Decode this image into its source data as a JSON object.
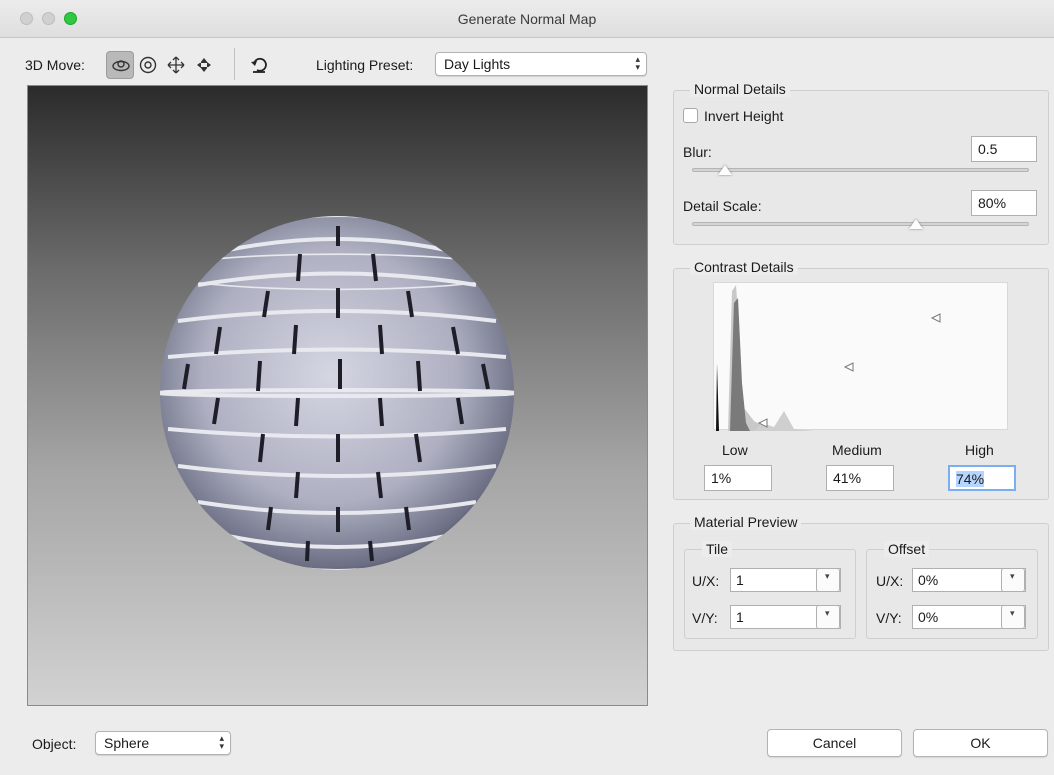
{
  "window": {
    "title": "Generate Normal Map"
  },
  "toolbar": {
    "move_label": "3D Move:",
    "tools": [
      "orbit-tool",
      "roll-tool",
      "pan-tool",
      "slide-tool"
    ],
    "reset_icon": "reset-view-icon",
    "lighting_label": "Lighting Preset:",
    "lighting_value": "Day Lights"
  },
  "normal_details": {
    "title": "Normal Details",
    "invert_height_label": "Invert Height",
    "invert_height_checked": false,
    "blur_label": "Blur:",
    "blur_value": "0.5",
    "detail_scale_label": "Detail Scale:",
    "detail_scale_value": "80%"
  },
  "contrast_details": {
    "title": "Contrast Details",
    "low_label": "Low",
    "medium_label": "Medium",
    "high_label": "High",
    "low_value": "1%",
    "medium_value": "41%",
    "high_value": "74%"
  },
  "material_preview": {
    "title": "Material Preview",
    "tile_title": "Tile",
    "offset_title": "Offset",
    "ux_label": "U/X:",
    "vy_label": "V/Y:",
    "tile_ux": "1",
    "tile_vy": "1",
    "offset_ux": "0%",
    "offset_vy": "0%"
  },
  "footer": {
    "object_label": "Object:",
    "object_value": "Sphere",
    "cancel_label": "Cancel",
    "ok_label": "OK"
  },
  "colors": {
    "accent_green": "#2fc840",
    "selection_blue": "#b5d5ff"
  }
}
